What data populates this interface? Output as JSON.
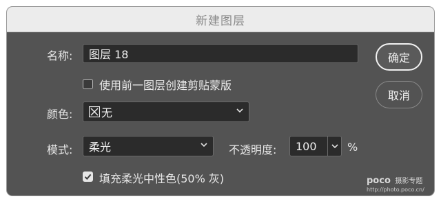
{
  "dialog": {
    "title": "新建图层"
  },
  "form": {
    "name_label": "名称:",
    "name_value": "图层 18",
    "clipping_label": "使用前一图层创建剪贴蒙版",
    "clipping_checked": false,
    "color_label": "颜色:",
    "color_value": "无",
    "mode_label": "模式:",
    "mode_value": "柔光",
    "opacity_label": "不透明度:",
    "opacity_value": "100",
    "opacity_unit": "%",
    "fill_label": "填充柔光中性色(50% 灰)",
    "fill_checked": true
  },
  "buttons": {
    "ok": "确定",
    "cancel": "取消"
  },
  "watermark": {
    "brand": "poco",
    "brand_cn": "摄影专题",
    "url": "http://photo.poco.cn/"
  },
  "icons": {
    "chevron": "chevron-down-icon",
    "checkmark": "checkmark-icon",
    "none_color": "no-color-swatch-icon"
  }
}
